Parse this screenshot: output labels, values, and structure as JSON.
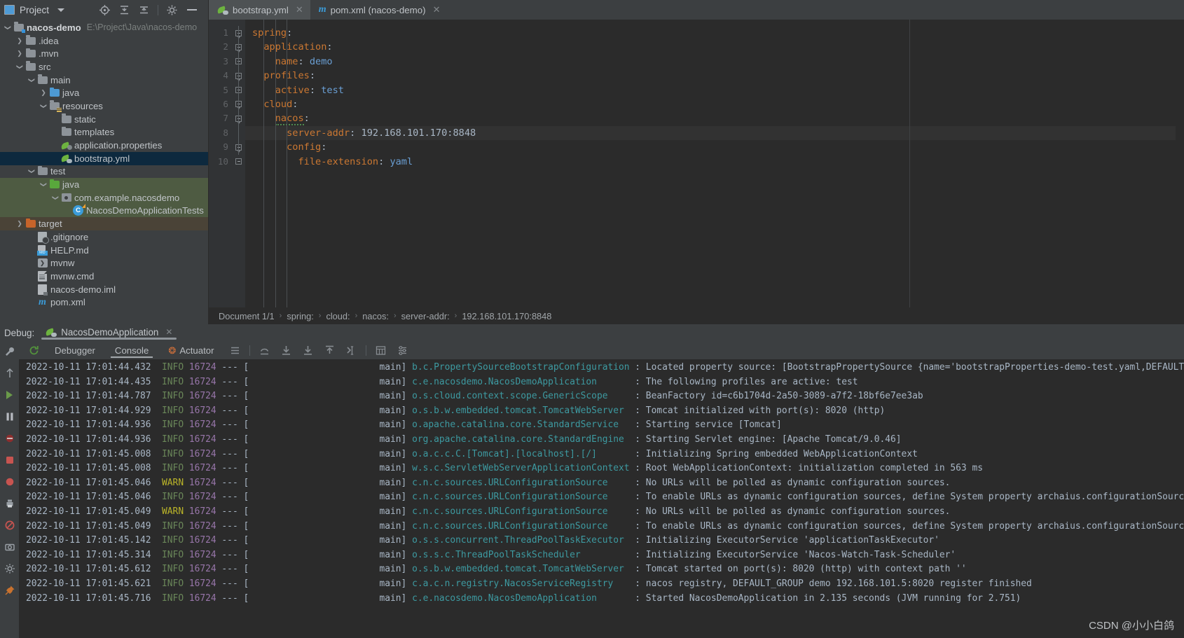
{
  "project_panel": {
    "title": "Project",
    "icons": [
      "project-view-icon",
      "locate-icon",
      "collapse-all-icon",
      "expand-icon",
      "settings-gear-icon",
      "minimize-icon"
    ],
    "tree": [
      {
        "label": "nacos-demo",
        "path": "E:\\Project\\Java\\nacos-demo",
        "indent": 0,
        "arrow": "down",
        "icon": "module-folder-icon",
        "style": "root"
      },
      {
        "label": ".idea",
        "indent": 1,
        "arrow": "right",
        "icon": "folder-gray-icon"
      },
      {
        "label": ".mvn",
        "indent": 1,
        "arrow": "right",
        "icon": "folder-gray-icon"
      },
      {
        "label": "src",
        "indent": 1,
        "arrow": "down",
        "icon": "folder-gray-icon"
      },
      {
        "label": "main",
        "indent": 2,
        "arrow": "down",
        "icon": "folder-gray-icon"
      },
      {
        "label": "java",
        "indent": 3,
        "arrow": "right",
        "icon": "folder-sources-blue-icon"
      },
      {
        "label": "resources",
        "indent": 3,
        "arrow": "down",
        "icon": "folder-resources-icon"
      },
      {
        "label": "static",
        "indent": 4,
        "arrow": "none",
        "icon": "folder-gray-icon"
      },
      {
        "label": "templates",
        "indent": 4,
        "arrow": "none",
        "icon": "folder-gray-icon"
      },
      {
        "label": "application.properties",
        "indent": 4,
        "arrow": "none",
        "icon": "spring-properties-icon"
      },
      {
        "label": "bootstrap.yml",
        "indent": 4,
        "arrow": "none",
        "icon": "spring-yaml-icon",
        "selected": "blue"
      },
      {
        "label": "test",
        "indent": 2,
        "arrow": "down",
        "icon": "folder-gray-icon"
      },
      {
        "label": "java",
        "indent": 3,
        "arrow": "down",
        "icon": "folder-test-green-icon",
        "selected": "green"
      },
      {
        "label": "com.example.nacosdemo",
        "indent": 4,
        "arrow": "down",
        "icon": "package-icon",
        "selected": "green"
      },
      {
        "label": "NacosDemoApplicationTests",
        "indent": 5,
        "arrow": "none",
        "icon": "test-class-icon",
        "selected": "green"
      },
      {
        "label": "target",
        "indent": 1,
        "arrow": "right",
        "icon": "folder-excluded-orange-icon",
        "selected": "brown"
      },
      {
        "label": ".gitignore",
        "indent": 2,
        "arrow": "none",
        "icon": "gitignore-file-icon"
      },
      {
        "label": "HELP.md",
        "indent": 2,
        "arrow": "none",
        "icon": "markdown-file-icon"
      },
      {
        "label": "mvnw",
        "indent": 2,
        "arrow": "none",
        "icon": "shell-script-icon"
      },
      {
        "label": "mvnw.cmd",
        "indent": 2,
        "arrow": "none",
        "icon": "text-file-icon"
      },
      {
        "label": "nacos-demo.iml",
        "indent": 2,
        "arrow": "none",
        "icon": "iml-file-icon"
      },
      {
        "label": "pom.xml",
        "indent": 2,
        "arrow": "none",
        "icon": "maven-file-icon"
      }
    ]
  },
  "editor": {
    "tabs": [
      {
        "label": "bootstrap.yml",
        "icon": "spring-yaml-icon",
        "active": true,
        "close": "✕"
      },
      {
        "label": "pom.xml (nacos-demo)",
        "icon": "maven-m-icon",
        "active": false,
        "close": "✕"
      }
    ],
    "lines": [
      {
        "num": "1",
        "indent": 0,
        "key": "spring",
        "value": "",
        "fold": "down"
      },
      {
        "num": "2",
        "indent": 1,
        "key": "application",
        "value": "",
        "fold": "down"
      },
      {
        "num": "3",
        "indent": 2,
        "key": "name",
        "value": "demo",
        "fold": "flat"
      },
      {
        "num": "4",
        "indent": 1,
        "key": "profiles",
        "value": "",
        "fold": "down"
      },
      {
        "num": "5",
        "indent": 2,
        "key": "active",
        "value": "test",
        "fold": "flat"
      },
      {
        "num": "6",
        "indent": 1,
        "key": "cloud",
        "value": "",
        "fold": "down"
      },
      {
        "num": "7",
        "indent": 2,
        "key": "nacos",
        "value": "",
        "fold": "down",
        "squiggle": true
      },
      {
        "num": "8",
        "indent": 3,
        "key": "server-addr",
        "value": "192.168.101.170:8848",
        "fold": "none",
        "current": true,
        "plain_value": true
      },
      {
        "num": "9",
        "indent": 3,
        "key": "config",
        "value": "",
        "fold": "down"
      },
      {
        "num": "10",
        "indent": 4,
        "key": "file-extension",
        "value": "yaml",
        "fold": "flat"
      }
    ],
    "breadcrumb": [
      "Document 1/1",
      "spring:",
      "cloud:",
      "nacos:",
      "server-addr:",
      "192.168.101.170:8848"
    ],
    "breadcrumb_separator": "›"
  },
  "debug_panel": {
    "label": "Debug:",
    "run_config": "NacosDemoApplication",
    "run_config_icon": "spring-boot-run-icon",
    "close": "✕",
    "rerun_icon": "rerun-icon",
    "tabs": [
      {
        "label": "Debugger",
        "active": false
      },
      {
        "label": "Console",
        "active": true
      },
      {
        "label": "Actuator",
        "active": false,
        "icon": "actuator-icon"
      }
    ],
    "toolbar_icons": [
      "toggle-soft-wrap-icon",
      "step-out-icon",
      "step-into-icon",
      "force-step-into-icon",
      "step-up-icon",
      "run-to-cursor-icon",
      "table-view-icon",
      "settings-icon"
    ],
    "rail_icons": [
      "wrench-icon",
      "up-arrow-icon",
      "resume-icon",
      "pause-icon",
      "mute-breakpoints-icon",
      "stop-icon",
      "view-breakpoints-icon",
      "print-icon",
      "no-entry-icon",
      "camera-icon",
      "settings-gear-icon",
      "pin-icon"
    ]
  },
  "console_log": [
    {
      "time": "2022-10-11 17:01:44.432",
      "level": "INFO",
      "pid": "16724",
      "thread": "main",
      "class": "b.c.PropertySourceBootstrapConfiguration",
      "msg": ": Located property source: [BootstrapPropertySource {name='bootstrapProperties-demo-test.yaml,DEFAULT_GR"
    },
    {
      "time": "2022-10-11 17:01:44.435",
      "level": "INFO",
      "pid": "16724",
      "thread": "main",
      "class": "c.e.nacosdemo.NacosDemoApplication",
      "msg": ": The following profiles are active: test"
    },
    {
      "time": "2022-10-11 17:01:44.787",
      "level": "INFO",
      "pid": "16724",
      "thread": "main",
      "class": "o.s.cloud.context.scope.GenericScope",
      "msg": ": BeanFactory id=c6b1704d-2a50-3089-a7f2-18bf6e7ee3ab"
    },
    {
      "time": "2022-10-11 17:01:44.929",
      "level": "INFO",
      "pid": "16724",
      "thread": "main",
      "class": "o.s.b.w.embedded.tomcat.TomcatWebServer",
      "msg": ": Tomcat initialized with port(s): 8020 (http)"
    },
    {
      "time": "2022-10-11 17:01:44.936",
      "level": "INFO",
      "pid": "16724",
      "thread": "main",
      "class": "o.apache.catalina.core.StandardService",
      "msg": ": Starting service [Tomcat]"
    },
    {
      "time": "2022-10-11 17:01:44.936",
      "level": "INFO",
      "pid": "16724",
      "thread": "main",
      "class": "org.apache.catalina.core.StandardEngine",
      "msg": ": Starting Servlet engine: [Apache Tomcat/9.0.46]"
    },
    {
      "time": "2022-10-11 17:01:45.008",
      "level": "INFO",
      "pid": "16724",
      "thread": "main",
      "class": "o.a.c.c.C.[Tomcat].[localhost].[/]",
      "msg": ": Initializing Spring embedded WebApplicationContext"
    },
    {
      "time": "2022-10-11 17:01:45.008",
      "level": "INFO",
      "pid": "16724",
      "thread": "main",
      "class": "w.s.c.ServletWebServerApplicationContext",
      "msg": ": Root WebApplicationContext: initialization completed in 563 ms"
    },
    {
      "time": "2022-10-11 17:01:45.046",
      "level": "WARN",
      "pid": "16724",
      "thread": "main",
      "class": "c.n.c.sources.URLConfigurationSource",
      "msg": ": No URLs will be polled as dynamic configuration sources."
    },
    {
      "time": "2022-10-11 17:01:45.046",
      "level": "INFO",
      "pid": "16724",
      "thread": "main",
      "class": "c.n.c.sources.URLConfigurationSource",
      "msg": ": To enable URLs as dynamic configuration sources, define System property archaius.configurationSource.a"
    },
    {
      "time": "2022-10-11 17:01:45.049",
      "level": "WARN",
      "pid": "16724",
      "thread": "main",
      "class": "c.n.c.sources.URLConfigurationSource",
      "msg": ": No URLs will be polled as dynamic configuration sources."
    },
    {
      "time": "2022-10-11 17:01:45.049",
      "level": "INFO",
      "pid": "16724",
      "thread": "main",
      "class": "c.n.c.sources.URLConfigurationSource",
      "msg": ": To enable URLs as dynamic configuration sources, define System property archaius.configurationSource.a"
    },
    {
      "time": "2022-10-11 17:01:45.142",
      "level": "INFO",
      "pid": "16724",
      "thread": "main",
      "class": "o.s.s.concurrent.ThreadPoolTaskExecutor",
      "msg": ": Initializing ExecutorService 'applicationTaskExecutor'"
    },
    {
      "time": "2022-10-11 17:01:45.314",
      "level": "INFO",
      "pid": "16724",
      "thread": "main",
      "class": "o.s.s.c.ThreadPoolTaskScheduler",
      "msg": ": Initializing ExecutorService 'Nacos-Watch-Task-Scheduler'"
    },
    {
      "time": "2022-10-11 17:01:45.612",
      "level": "INFO",
      "pid": "16724",
      "thread": "main",
      "class": "o.s.b.w.embedded.tomcat.TomcatWebServer",
      "msg": ": Tomcat started on port(s): 8020 (http) with context path ''"
    },
    {
      "time": "2022-10-11 17:01:45.621",
      "level": "INFO",
      "pid": "16724",
      "thread": "main",
      "class": "c.a.c.n.registry.NacosServiceRegistry",
      "msg": ": nacos registry, DEFAULT_GROUP demo 192.168.101.5:8020 register finished"
    },
    {
      "time": "2022-10-11 17:01:45.716",
      "level": "INFO",
      "pid": "16724",
      "thread": "main",
      "class": "c.e.nacosdemo.NacosDemoApplication",
      "msg": ": Started NacosDemoApplication in 2.135 seconds (JVM running for 2.751)"
    }
  ],
  "watermark": "CSDN @小小白鸽",
  "colors": {
    "bg_panel": "#3c3f41",
    "bg_editor": "#2b2b2b",
    "accent_key": "#cc7832",
    "accent_value": "#6a9fd4",
    "selection_blue": "#0d293e",
    "selection_green": "#4e5b42",
    "info": "#6a8759",
    "warn": "#bbb529",
    "logger": "#3d9aa1"
  }
}
